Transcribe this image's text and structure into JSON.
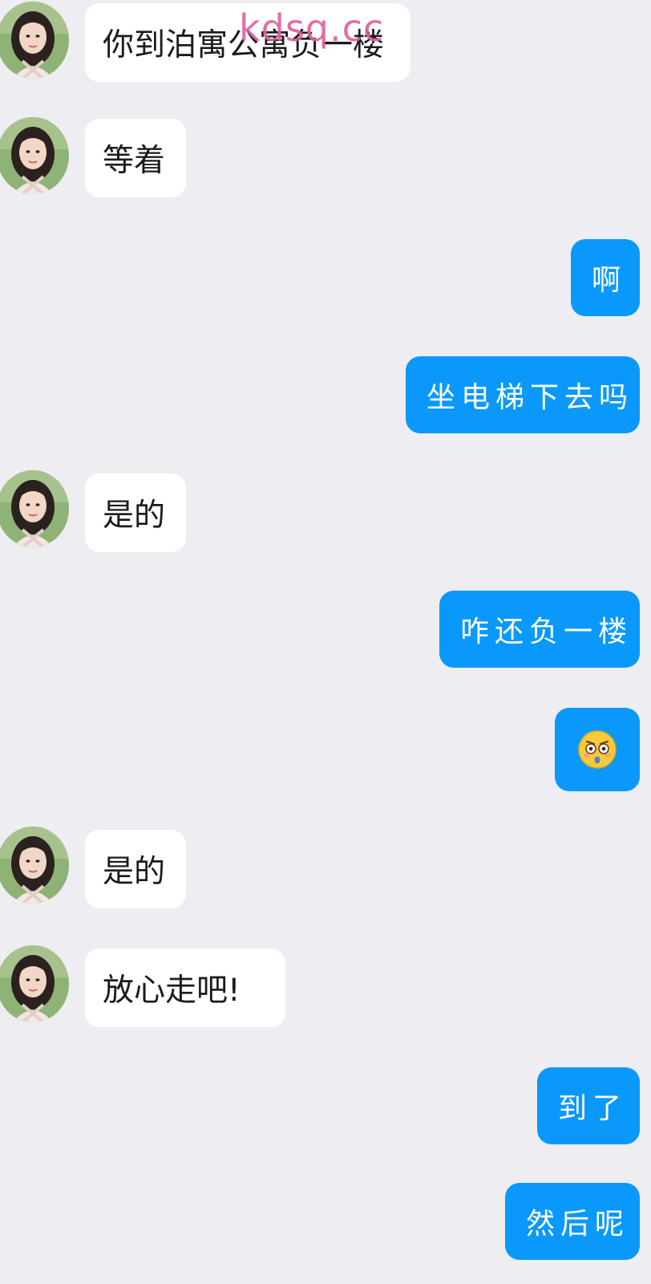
{
  "watermark": "kdsq.cc",
  "messages": [
    {
      "side": "in",
      "text": "你到泊寓公寓负一楼"
    },
    {
      "side": "in",
      "text": "等着"
    },
    {
      "side": "out",
      "text": "啊"
    },
    {
      "side": "out",
      "text": "坐电梯下去吗"
    },
    {
      "side": "in",
      "text": "是的"
    },
    {
      "side": "out",
      "text": "咋还负一楼"
    },
    {
      "side": "out",
      "emoji": "flushed-face-emoji"
    },
    {
      "side": "in",
      "text": "是的"
    },
    {
      "side": "in",
      "text": "放心走吧!"
    },
    {
      "side": "out",
      "text": "到了"
    },
    {
      "side": "out",
      "text": "然后呢"
    }
  ],
  "colors": {
    "background": "#ededf2",
    "incoming_bubble": "#ffffff",
    "outgoing_bubble": "#0a99fb",
    "watermark": "#de5fa0"
  }
}
